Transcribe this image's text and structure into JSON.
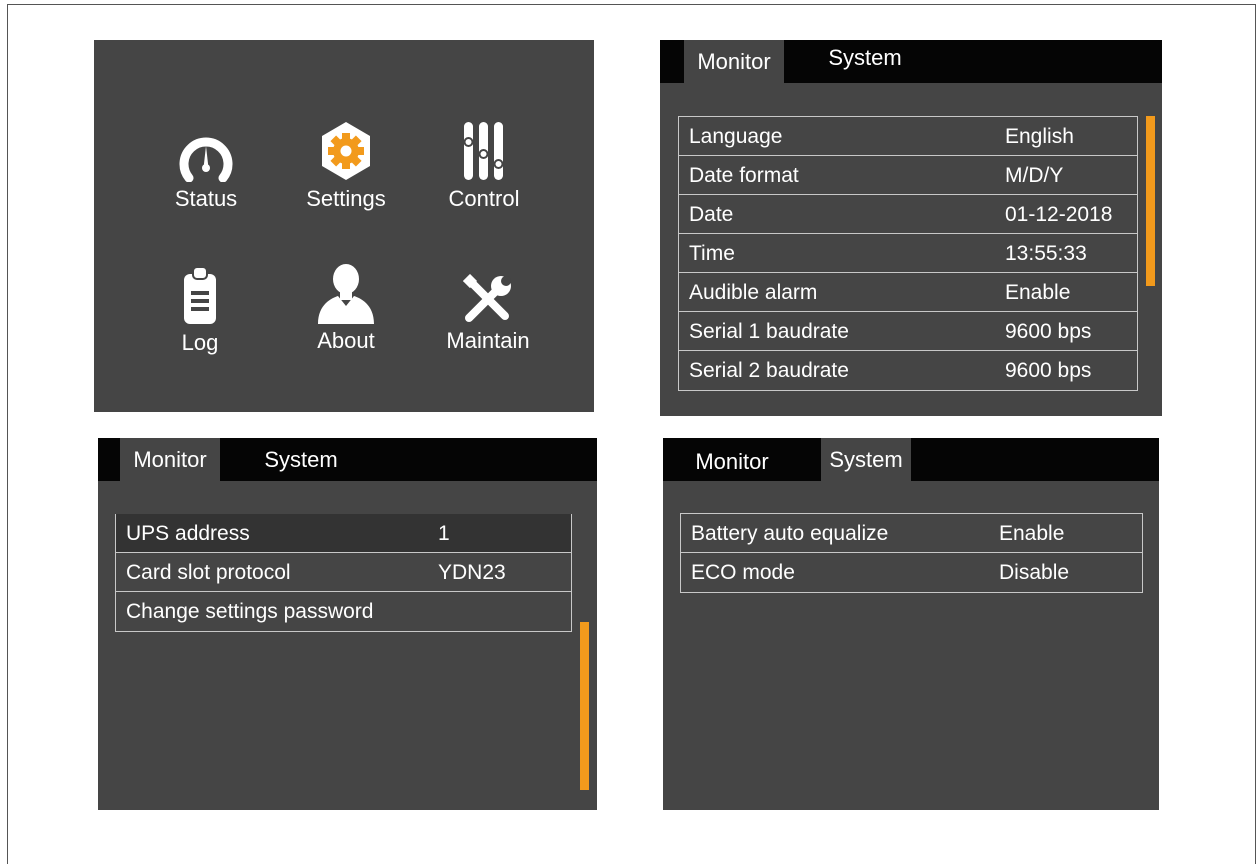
{
  "menu": {
    "items": [
      {
        "label": "Status",
        "icon": "gauge-icon"
      },
      {
        "label": "Settings",
        "icon": "gear-icon"
      },
      {
        "label": "Control",
        "icon": "sliders-icon"
      },
      {
        "label": "Log",
        "icon": "clipboard-icon"
      },
      {
        "label": "About",
        "icon": "person-icon"
      },
      {
        "label": "Maintain",
        "icon": "tools-icon"
      }
    ]
  },
  "tabs": {
    "monitor": "Monitor",
    "system": "System"
  },
  "monitor_settings": {
    "rows": [
      {
        "key": "Language",
        "value": "English"
      },
      {
        "key": "Date format",
        "value": "M/D/Y"
      },
      {
        "key": "Date",
        "value": "01-12-2018"
      },
      {
        "key": "Time",
        "value": "13:55:33"
      },
      {
        "key": "Audible alarm",
        "value": "Enable"
      },
      {
        "key": "Serial 1 baudrate",
        "value": "9600 bps"
      },
      {
        "key": "Serial 2 baudrate",
        "value": "9600 bps"
      }
    ]
  },
  "monitor_settings_2": {
    "rows": [
      {
        "key": "UPS address",
        "value": "1"
      },
      {
        "key": "Card slot protocol",
        "value": "YDN23"
      },
      {
        "key": "Change settings password",
        "value": ""
      }
    ]
  },
  "system_settings": {
    "rows": [
      {
        "key": "Battery auto equalize",
        "value": "Enable"
      },
      {
        "key": "ECO mode",
        "value": "Disable"
      }
    ]
  },
  "colors": {
    "panel": "#454545",
    "tabbar": "#050505",
    "accent": "#f29a1c",
    "text": "#ffffff"
  }
}
